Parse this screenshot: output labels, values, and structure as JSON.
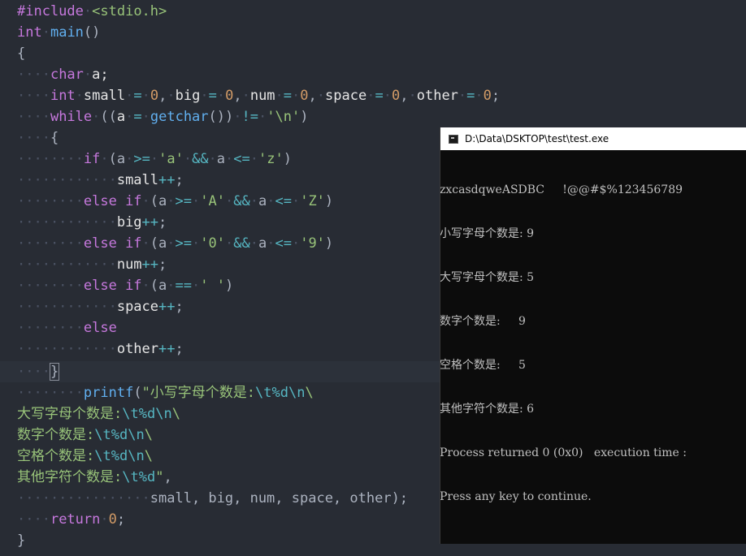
{
  "code": {
    "l1": {
      "directive": "#include",
      "header": "<stdio.h>"
    },
    "l2": {
      "type": "int",
      "name": "main",
      "parens": "()"
    },
    "l3": {
      "open": "{"
    },
    "l4": {
      "type": "char",
      "rest": "a;"
    },
    "l5": {
      "type": "int",
      "v1": "small",
      "v2": "big",
      "v3": "num",
      "v4": "space",
      "v5": "other",
      "zero": "0"
    },
    "l6": {
      "kw": "while",
      "fn": "getchar",
      "char": "'\\n'",
      "a": "a"
    },
    "l7": {
      "open": "{"
    },
    "cond1": {
      "kw": "if",
      "lo": "'a'",
      "hi": "'z'"
    },
    "inc1": {
      "var": "small",
      "op": "++",
      "end": ";"
    },
    "cond2": {
      "kw": "else if",
      "lo": "'A'",
      "hi": "'Z'"
    },
    "inc2": {
      "var": "big"
    },
    "cond3": {
      "kw": "else if",
      "lo": "'0'",
      "hi": "'9'"
    },
    "inc3": {
      "var": "num"
    },
    "cond4": {
      "kw": "else if",
      "sp": "' '"
    },
    "inc4": {
      "var": "space"
    },
    "else": {
      "kw": "else"
    },
    "inc5": {
      "var": "other"
    },
    "l18": {
      "close": "}"
    },
    "printf": {
      "fn": "printf",
      "s1": "\"小写字母个数是:",
      "s2": "大写字母个数是:",
      "s3": "数字个数是:",
      "s4": "空格个数是:",
      "s5": "其他字符个数是:",
      "tab": "\\t",
      "fmt": "%d",
      "nl": "\\n",
      "bs": "\\",
      "q": "\"",
      "args": "small, big, num, space, other);"
    },
    "ret": {
      "kw": "return",
      "val": "0",
      "end": ";"
    },
    "l25": {
      "close": "}"
    }
  },
  "console": {
    "title": "D:\\Data\\DSKTOP\\test\\test.exe",
    "lines": [
      "zxcasdqweASDBC     !@@#$%123456789",
      "小写字母个数是: 9",
      "大写字母个数是: 5",
      "数字个数是:     9",
      "空格个数是:     5",
      "其他字符个数是: 6",
      "Process returned 0 (0x0)   execution time :",
      "Press any key to continue."
    ]
  }
}
